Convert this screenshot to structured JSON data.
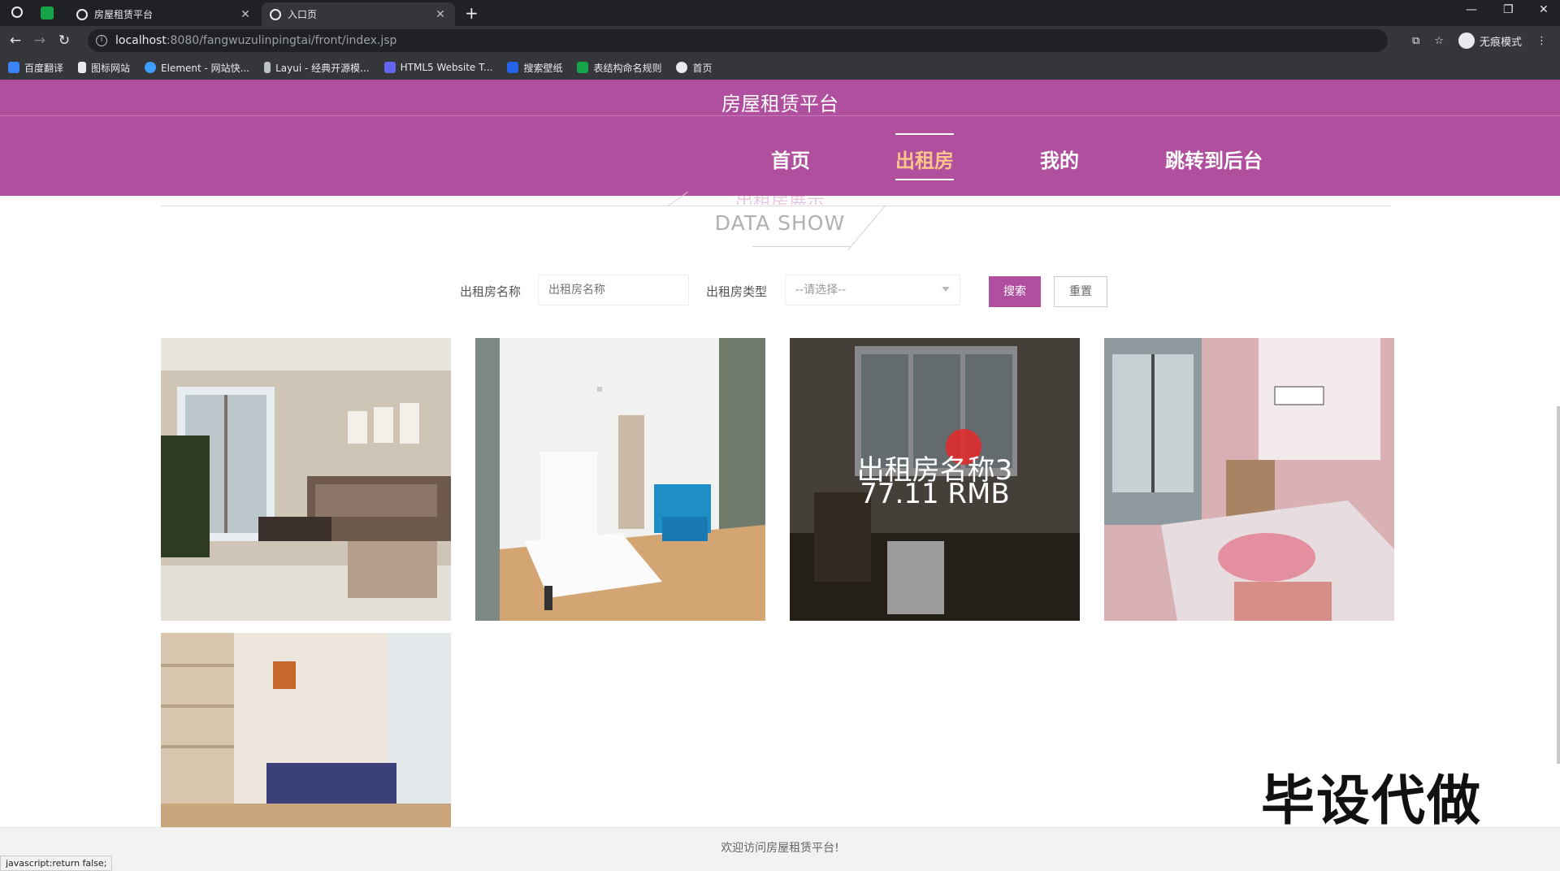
{
  "browser": {
    "tabs": [
      {
        "title": "房屋租赁平台",
        "active": false
      },
      {
        "title": "入口页",
        "active": true
      }
    ],
    "url_host": "localhost",
    "url_path": ":8080/fangwuzulinpingtai/front/index.jsp",
    "incognito_label": "无痕模式",
    "bookmarks": [
      "百度翻译",
      "图标网站",
      "Element - 网站快...",
      "Layui - 经典开源模...",
      "HTML5 Website T...",
      "搜索壁纸",
      "表结构命名规则",
      "首页"
    ],
    "status_text": "javascript:return false;"
  },
  "header": {
    "site_title": "房屋租赁平台",
    "nav": [
      "首页",
      "出租房",
      "我的",
      "跳转到后台"
    ],
    "active_index": 1
  },
  "section": {
    "title": "DATA SHOW",
    "ghost_title": "出租房展示"
  },
  "search": {
    "name_label": "出租房名称",
    "name_placeholder": "出租房名称",
    "type_label": "出租房类型",
    "type_selected": "--请选择--",
    "search_button": "搜索",
    "reset_button": "重置"
  },
  "listings": [
    {
      "kind": "living-room"
    },
    {
      "kind": "bedroom-white"
    },
    {
      "kind": "room-dark",
      "name": "出租房名称3",
      "price": "77.11 RMB"
    },
    {
      "kind": "bedroom-pink"
    },
    {
      "kind": "bedroom-blue"
    }
  ],
  "watermark": "毕设代做",
  "footer": {
    "text": "欢迎访问房屋租赁平台!"
  },
  "colors": {
    "brand": "#b14f9f",
    "active_nav": "#ffc58a"
  }
}
